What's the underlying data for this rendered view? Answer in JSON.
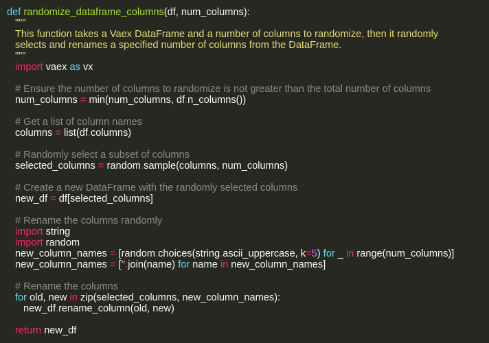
{
  "theme": {
    "background": "#272822",
    "foreground": "#f8f8f2",
    "keyword": "#f92672",
    "builtin_keyword": "#66d9ef",
    "function_name": "#a6e22e",
    "string": "#e6db74",
    "comment": "#8e8c80",
    "number": "#ae81ff"
  },
  "code": {
    "def_kw": "def",
    "func_name": "randomize_dataframe_columns",
    "def_params": "(df, num_columns):",
    "doc_open": "\"\"\"",
    "doc_line1": "This function takes a Vaex DataFrame and a number of columns to randomize, then it randomly",
    "doc_line2": "selects and renames a specified number of columns from the DataFrame.",
    "doc_close": "\"\"\"",
    "import_kw": "import",
    "import_mod": "vaex",
    "as_kw": "as",
    "import_alias": "vx",
    "comment1": "# Ensure the number of columns to randomize is not greater than the total number of columns",
    "l8_lhs": "num_columns",
    "l8_eq": "=",
    "l8_a": "min(num_columns, df",
    "l8_dot": ".",
    "l8_b": "n_columns())",
    "comment2": "# Get a list of column names",
    "l11_lhs": "columns",
    "l11_eq": "=",
    "l11_a": "list(df",
    "l11_dot": ".",
    "l11_b": "columns)",
    "comment3": "# Randomly select a subset of columns",
    "l14_lhs": "selected_columns",
    "l14_eq": "=",
    "l14_a": "random",
    "l14_dot": ".",
    "l14_b": "sample(columns, num_columns)",
    "comment4": "# Create a new DataFrame with the randomly selected columns",
    "l17_lhs": "new_df",
    "l17_eq": "=",
    "l17_rhs": "df[selected_columns]",
    "comment5": "# Rename the columns randomly",
    "imp2_kw": "import",
    "imp2_mod": "string",
    "imp3_kw": "import",
    "imp3_mod": "random",
    "l23_lhs": "new_column_names",
    "l23_eq": "=",
    "l23_a": "[random",
    "l23_dot1": ".",
    "l23_b": "choices(string",
    "l23_dot2": ".",
    "l23_c": "ascii_uppercase, k",
    "l23_eq2": "=",
    "l23_num": "5",
    "l23_d": ") ",
    "l23_for": "for",
    "l23_e": " _ ",
    "l23_in": "in",
    "l23_f": " range(num_columns)]",
    "l24_lhs": "new_column_names",
    "l24_eq": "=",
    "l24_a": "[",
    "l24_str": "''",
    "l24_dot": ".",
    "l24_b": "join(name) ",
    "l24_for": "for",
    "l24_c": " name ",
    "l24_in": "in",
    "l24_d": " new_column_names]",
    "comment6": "# Rename the columns",
    "l27_for": "for",
    "l27_a": " old, new ",
    "l27_in": "in",
    "l27_b": " zip(selected_columns, new_column_names):",
    "l28_a": "new_df",
    "l28_dot": ".",
    "l28_b": "rename_column(old, new)",
    "ret_kw": "return",
    "ret_val": "new_df"
  }
}
